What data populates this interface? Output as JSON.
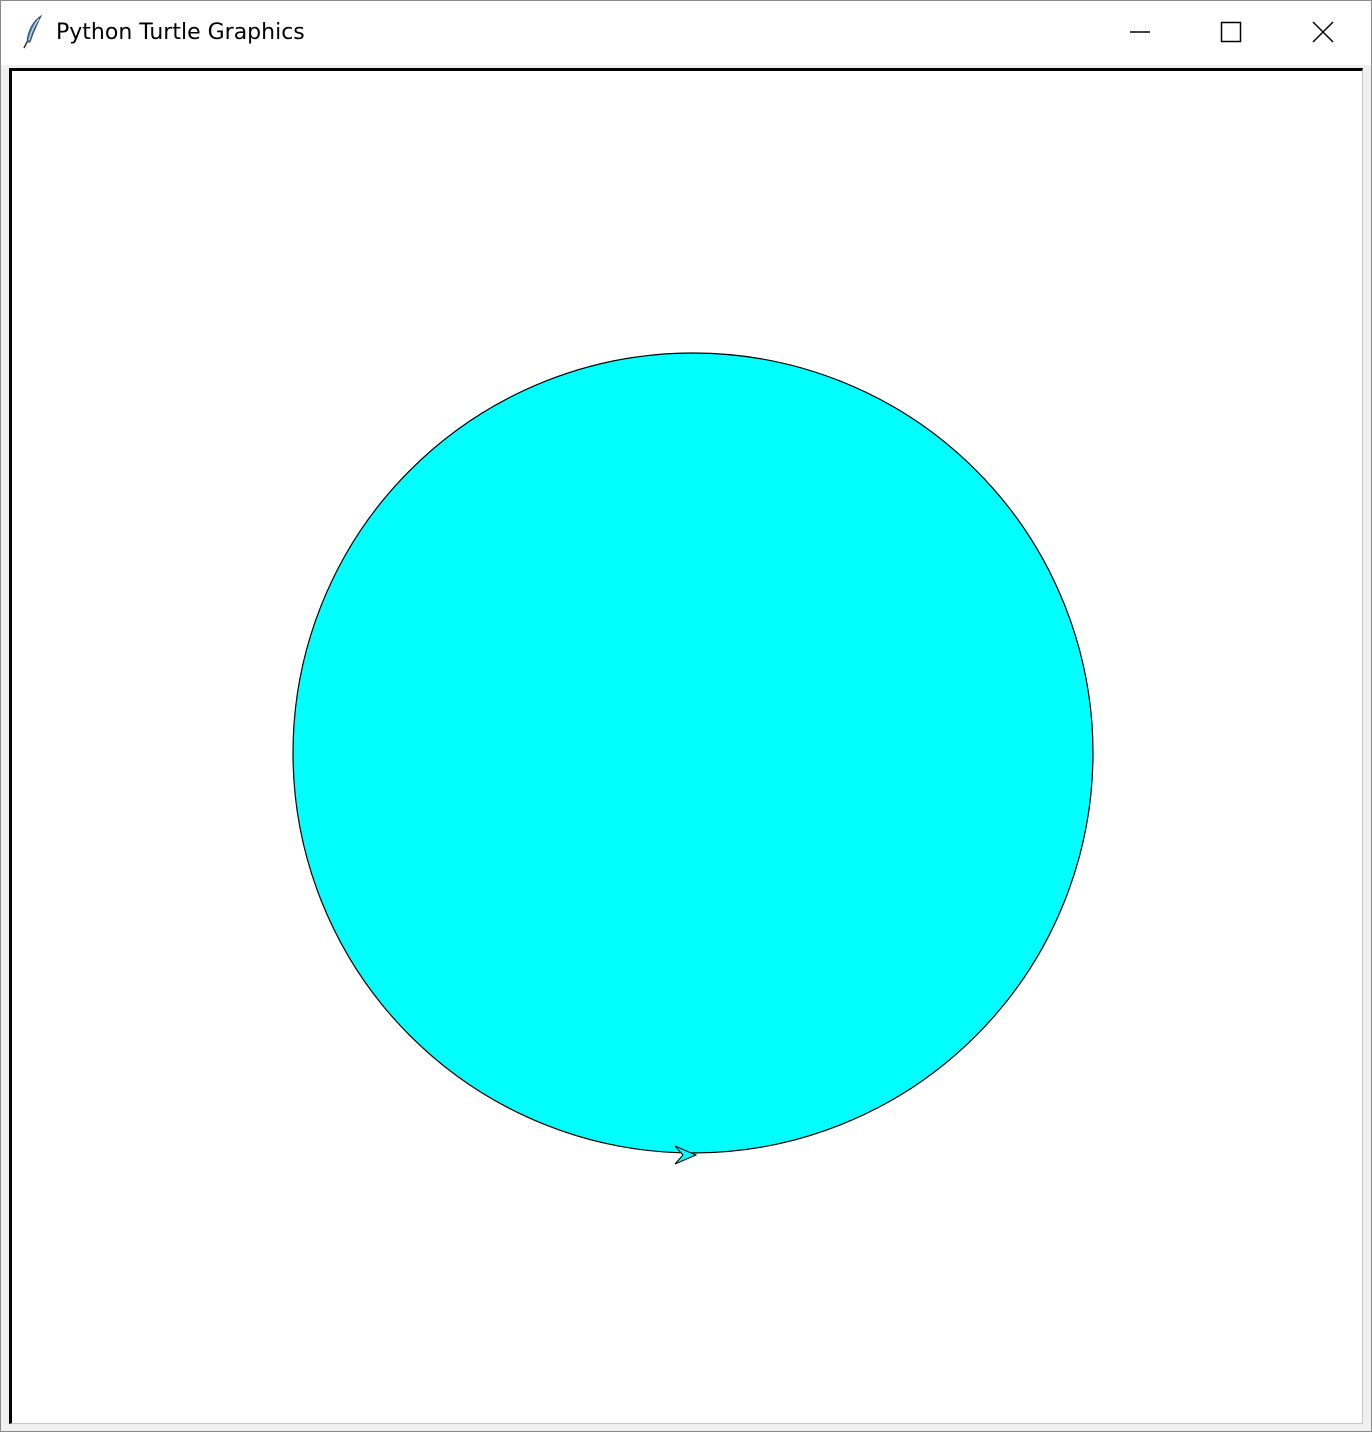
{
  "window": {
    "title": "Python Turtle Graphics",
    "app_icon": "feather-icon",
    "controls": {
      "minimize_icon": "minimize-icon",
      "maximize_icon": "maximize-icon",
      "close_icon": "close-icon"
    }
  },
  "canvas": {
    "background_color": "#ffffff",
    "shape": {
      "type": "circle",
      "fill_color": "#00ffff",
      "outline_color": "#000000"
    },
    "turtle": {
      "shape": "arrow",
      "fill_color": "#00ffff",
      "outline_color": "#000000",
      "heading": "east"
    }
  }
}
